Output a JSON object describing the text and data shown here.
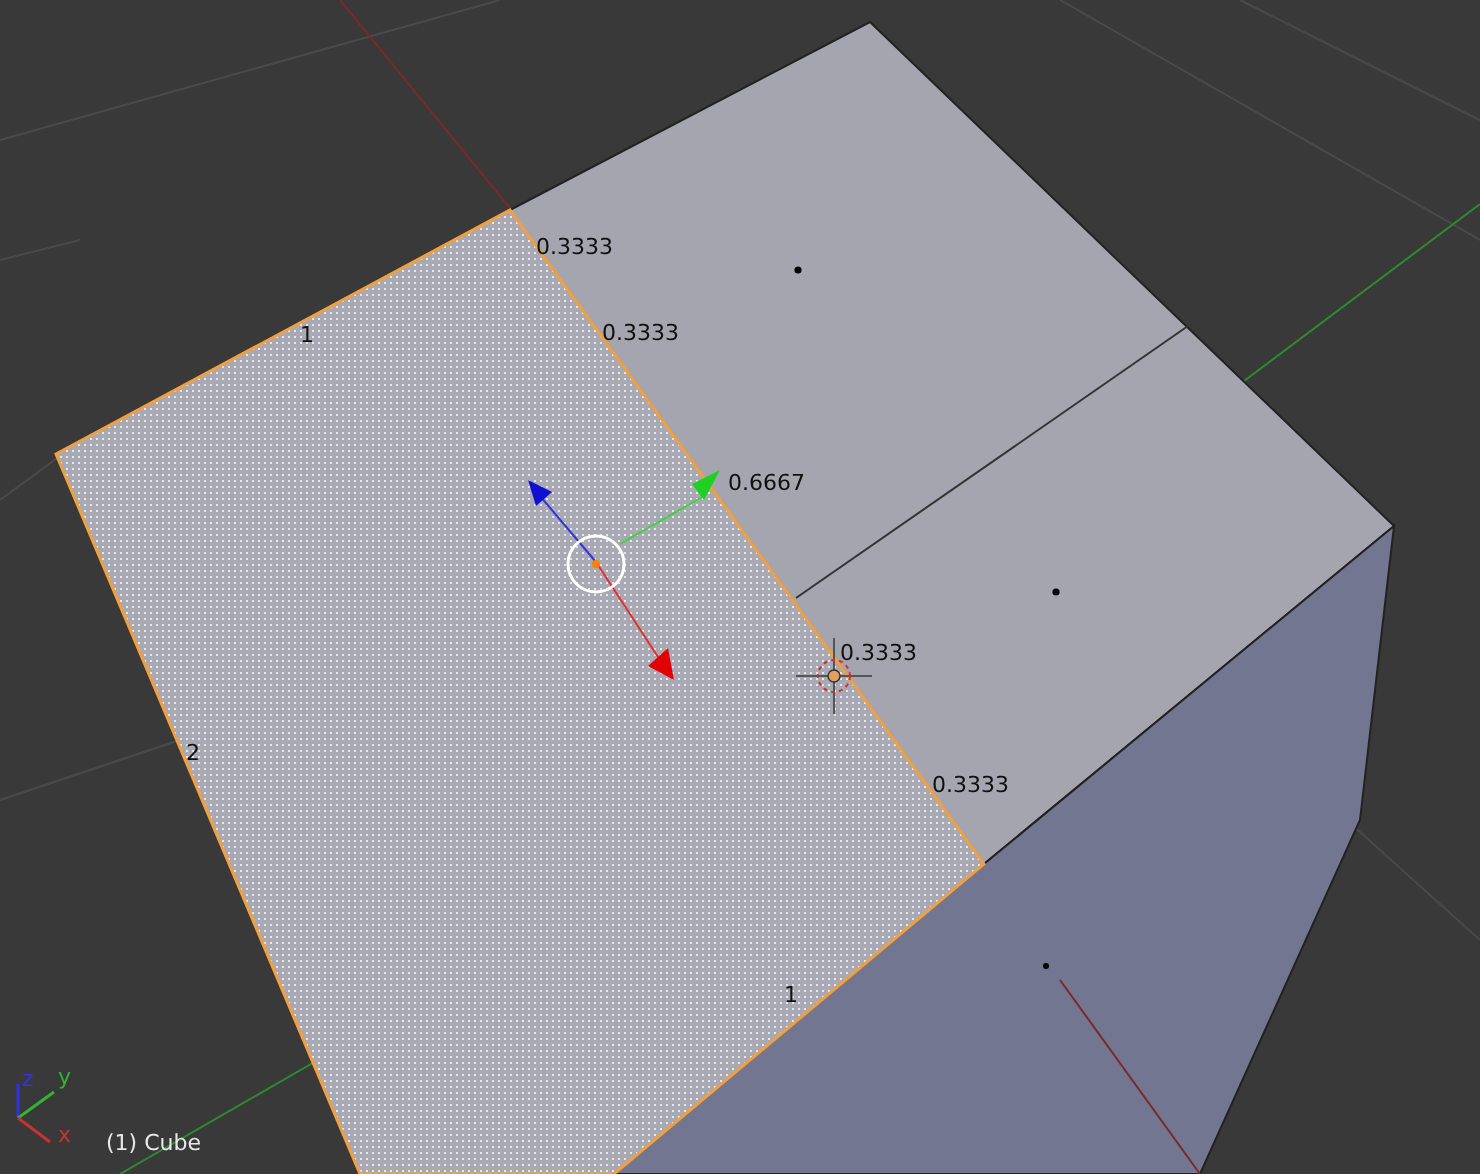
{
  "viewport": {
    "edge_labels": [
      {
        "text": "0.3333"
      },
      {
        "text": "1"
      },
      {
        "text": "0.3333"
      },
      {
        "text": "0.6667"
      },
      {
        "text": "0.3333"
      },
      {
        "text": "2"
      },
      {
        "text": "0.3333"
      },
      {
        "text": "1"
      }
    ],
    "axis_labels": [
      {
        "text": "z",
        "kind": "z"
      },
      {
        "text": "y",
        "kind": "y"
      },
      {
        "text": "x",
        "kind": "x"
      }
    ],
    "object_name": "(1) Cube"
  }
}
